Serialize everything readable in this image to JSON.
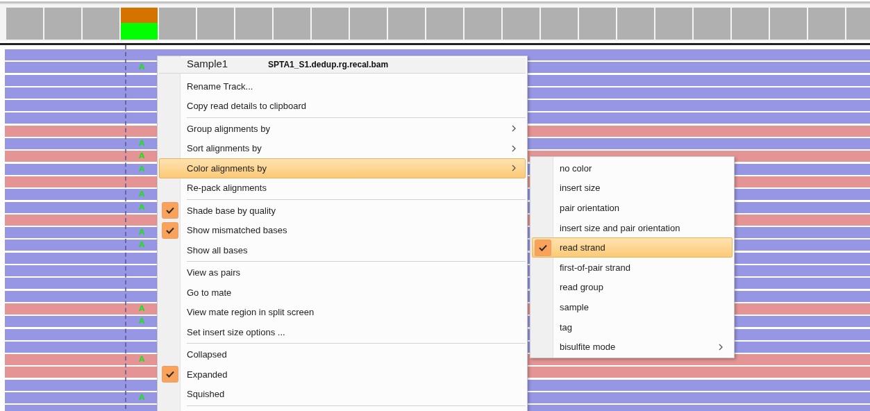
{
  "coverage": [
    {
      "mismatch": false
    },
    {
      "mismatch": false
    },
    {
      "mismatch": false
    },
    {
      "mismatch": true
    },
    {
      "mismatch": false
    },
    {
      "mismatch": false
    },
    {
      "mismatch": false
    },
    {
      "mismatch": false
    },
    {
      "mismatch": false
    },
    {
      "mismatch": false
    },
    {
      "mismatch": false
    },
    {
      "mismatch": false
    },
    {
      "mismatch": false
    },
    {
      "mismatch": false
    },
    {
      "mismatch": false
    },
    {
      "mismatch": false
    },
    {
      "mismatch": false
    },
    {
      "mismatch": false
    },
    {
      "mismatch": false
    },
    {
      "mismatch": false
    },
    {
      "mismatch": false
    },
    {
      "mismatch": false
    },
    {
      "mismatch": false
    }
  ],
  "reads": [
    {
      "reverse": false
    },
    {
      "reverse": false,
      "mismatch": "A"
    },
    {
      "reverse": false
    },
    {
      "reverse": false
    },
    {
      "reverse": false
    },
    {
      "reverse": false
    },
    {
      "reverse": true
    },
    {
      "reverse": false,
      "mismatch": "A"
    },
    {
      "reverse": true,
      "mismatch": "A"
    },
    {
      "reverse": false,
      "mismatch": "A"
    },
    {
      "reverse": true
    },
    {
      "reverse": false,
      "mismatch": "A"
    },
    {
      "reverse": false,
      "mismatch": "A"
    },
    {
      "reverse": true
    },
    {
      "reverse": false,
      "mismatch": "A"
    },
    {
      "reverse": false,
      "mismatch": "A"
    },
    {
      "reverse": false
    },
    {
      "reverse": false
    },
    {
      "reverse": false
    },
    {
      "reverse": false
    },
    {
      "reverse": true,
      "mismatch": "A"
    },
    {
      "reverse": false,
      "mismatch": "A"
    },
    {
      "reverse": false
    },
    {
      "reverse": false
    },
    {
      "reverse": true,
      "mismatch": "A"
    },
    {
      "reverse": true
    },
    {
      "reverse": false
    },
    {
      "reverse": false,
      "mismatch": "A"
    },
    {
      "reverse": false
    }
  ],
  "menu": {
    "title": "Sample1",
    "track_file": "SPTA1_S1.dedup.rg.recal.bam",
    "sections": [
      {
        "items": [
          {
            "label": "Rename Track...",
            "checked": false,
            "selected": false,
            "submenu": false
          },
          {
            "label": "Copy read details to clipboard",
            "checked": false,
            "selected": false,
            "submenu": false
          }
        ]
      },
      {
        "items": [
          {
            "label": "Group alignments by",
            "checked": false,
            "selected": false,
            "submenu": true
          },
          {
            "label": "Sort alignments by",
            "checked": false,
            "selected": false,
            "submenu": true
          },
          {
            "label": "Color alignments by",
            "checked": false,
            "selected": true,
            "submenu": true
          },
          {
            "label": "Re-pack alignments",
            "checked": false,
            "selected": false,
            "submenu": false
          }
        ]
      },
      {
        "items": [
          {
            "label": "Shade base by quality",
            "checked": true,
            "selected": false,
            "submenu": false
          },
          {
            "label": "Show mismatched bases",
            "checked": true,
            "selected": false,
            "submenu": false
          },
          {
            "label": "Show all bases",
            "checked": false,
            "selected": false,
            "submenu": false
          }
        ]
      },
      {
        "items": [
          {
            "label": "View as pairs",
            "checked": false,
            "selected": false,
            "submenu": false
          },
          {
            "label": "Go to mate",
            "checked": false,
            "selected": false,
            "submenu": false
          },
          {
            "label": "View mate region in split screen",
            "checked": false,
            "selected": false,
            "submenu": false
          },
          {
            "label": "Set insert size options ...",
            "checked": false,
            "selected": false,
            "submenu": false
          }
        ]
      },
      {
        "items": [
          {
            "label": "Collapsed",
            "checked": false,
            "selected": false,
            "submenu": false
          },
          {
            "label": "Expanded",
            "checked": true,
            "selected": false,
            "submenu": false
          },
          {
            "label": "Squished",
            "checked": false,
            "selected": false,
            "submenu": false
          }
        ]
      }
    ]
  },
  "submenu": {
    "items": [
      {
        "label": "no color",
        "checked": false,
        "selected": false,
        "submenu": false
      },
      {
        "label": "insert size",
        "checked": false,
        "selected": false,
        "submenu": false
      },
      {
        "label": "pair orientation",
        "checked": false,
        "selected": false,
        "submenu": false
      },
      {
        "label": "insert size and pair orientation",
        "checked": false,
        "selected": false,
        "submenu": false
      },
      {
        "label": "read strand",
        "checked": true,
        "selected": true,
        "submenu": false
      },
      {
        "label": "first-of-pair strand",
        "checked": false,
        "selected": false,
        "submenu": false
      },
      {
        "label": "read group",
        "checked": false,
        "selected": false,
        "submenu": false
      },
      {
        "label": "sample",
        "checked": false,
        "selected": false,
        "submenu": false
      },
      {
        "label": "tag",
        "checked": false,
        "selected": false,
        "submenu": false
      },
      {
        "label": "bisulfite mode",
        "checked": false,
        "selected": false,
        "submenu": true
      }
    ]
  }
}
